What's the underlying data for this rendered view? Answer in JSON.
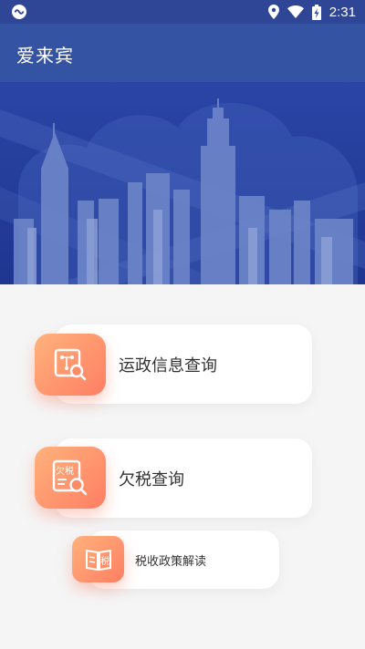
{
  "status_bar": {
    "time": "2:31",
    "icons": [
      "app-notification-icon",
      "location-icon",
      "wifi-icon",
      "battery-charging-icon"
    ]
  },
  "app_bar": {
    "title": "爱来宾"
  },
  "banner": {
    "icon": "city-skyline-illustration"
  },
  "menu": {
    "items": [
      {
        "label": "运政信息查询",
        "icon": "transport-info-search-icon"
      },
      {
        "label": "欠税查询",
        "icon": "tax-arrears-search-icon",
        "icon_text": "欠税"
      },
      {
        "label": "税收政策解读",
        "icon": "tax-policy-book-icon",
        "icon_text": "税"
      }
    ]
  },
  "colors": {
    "app_bar": "#3553a3",
    "status_bar": "#2f4595",
    "banner": "#27419b",
    "tile_start": "#ffb27c",
    "tile_end": "#ff7e63",
    "background": "#f5f5f6"
  }
}
